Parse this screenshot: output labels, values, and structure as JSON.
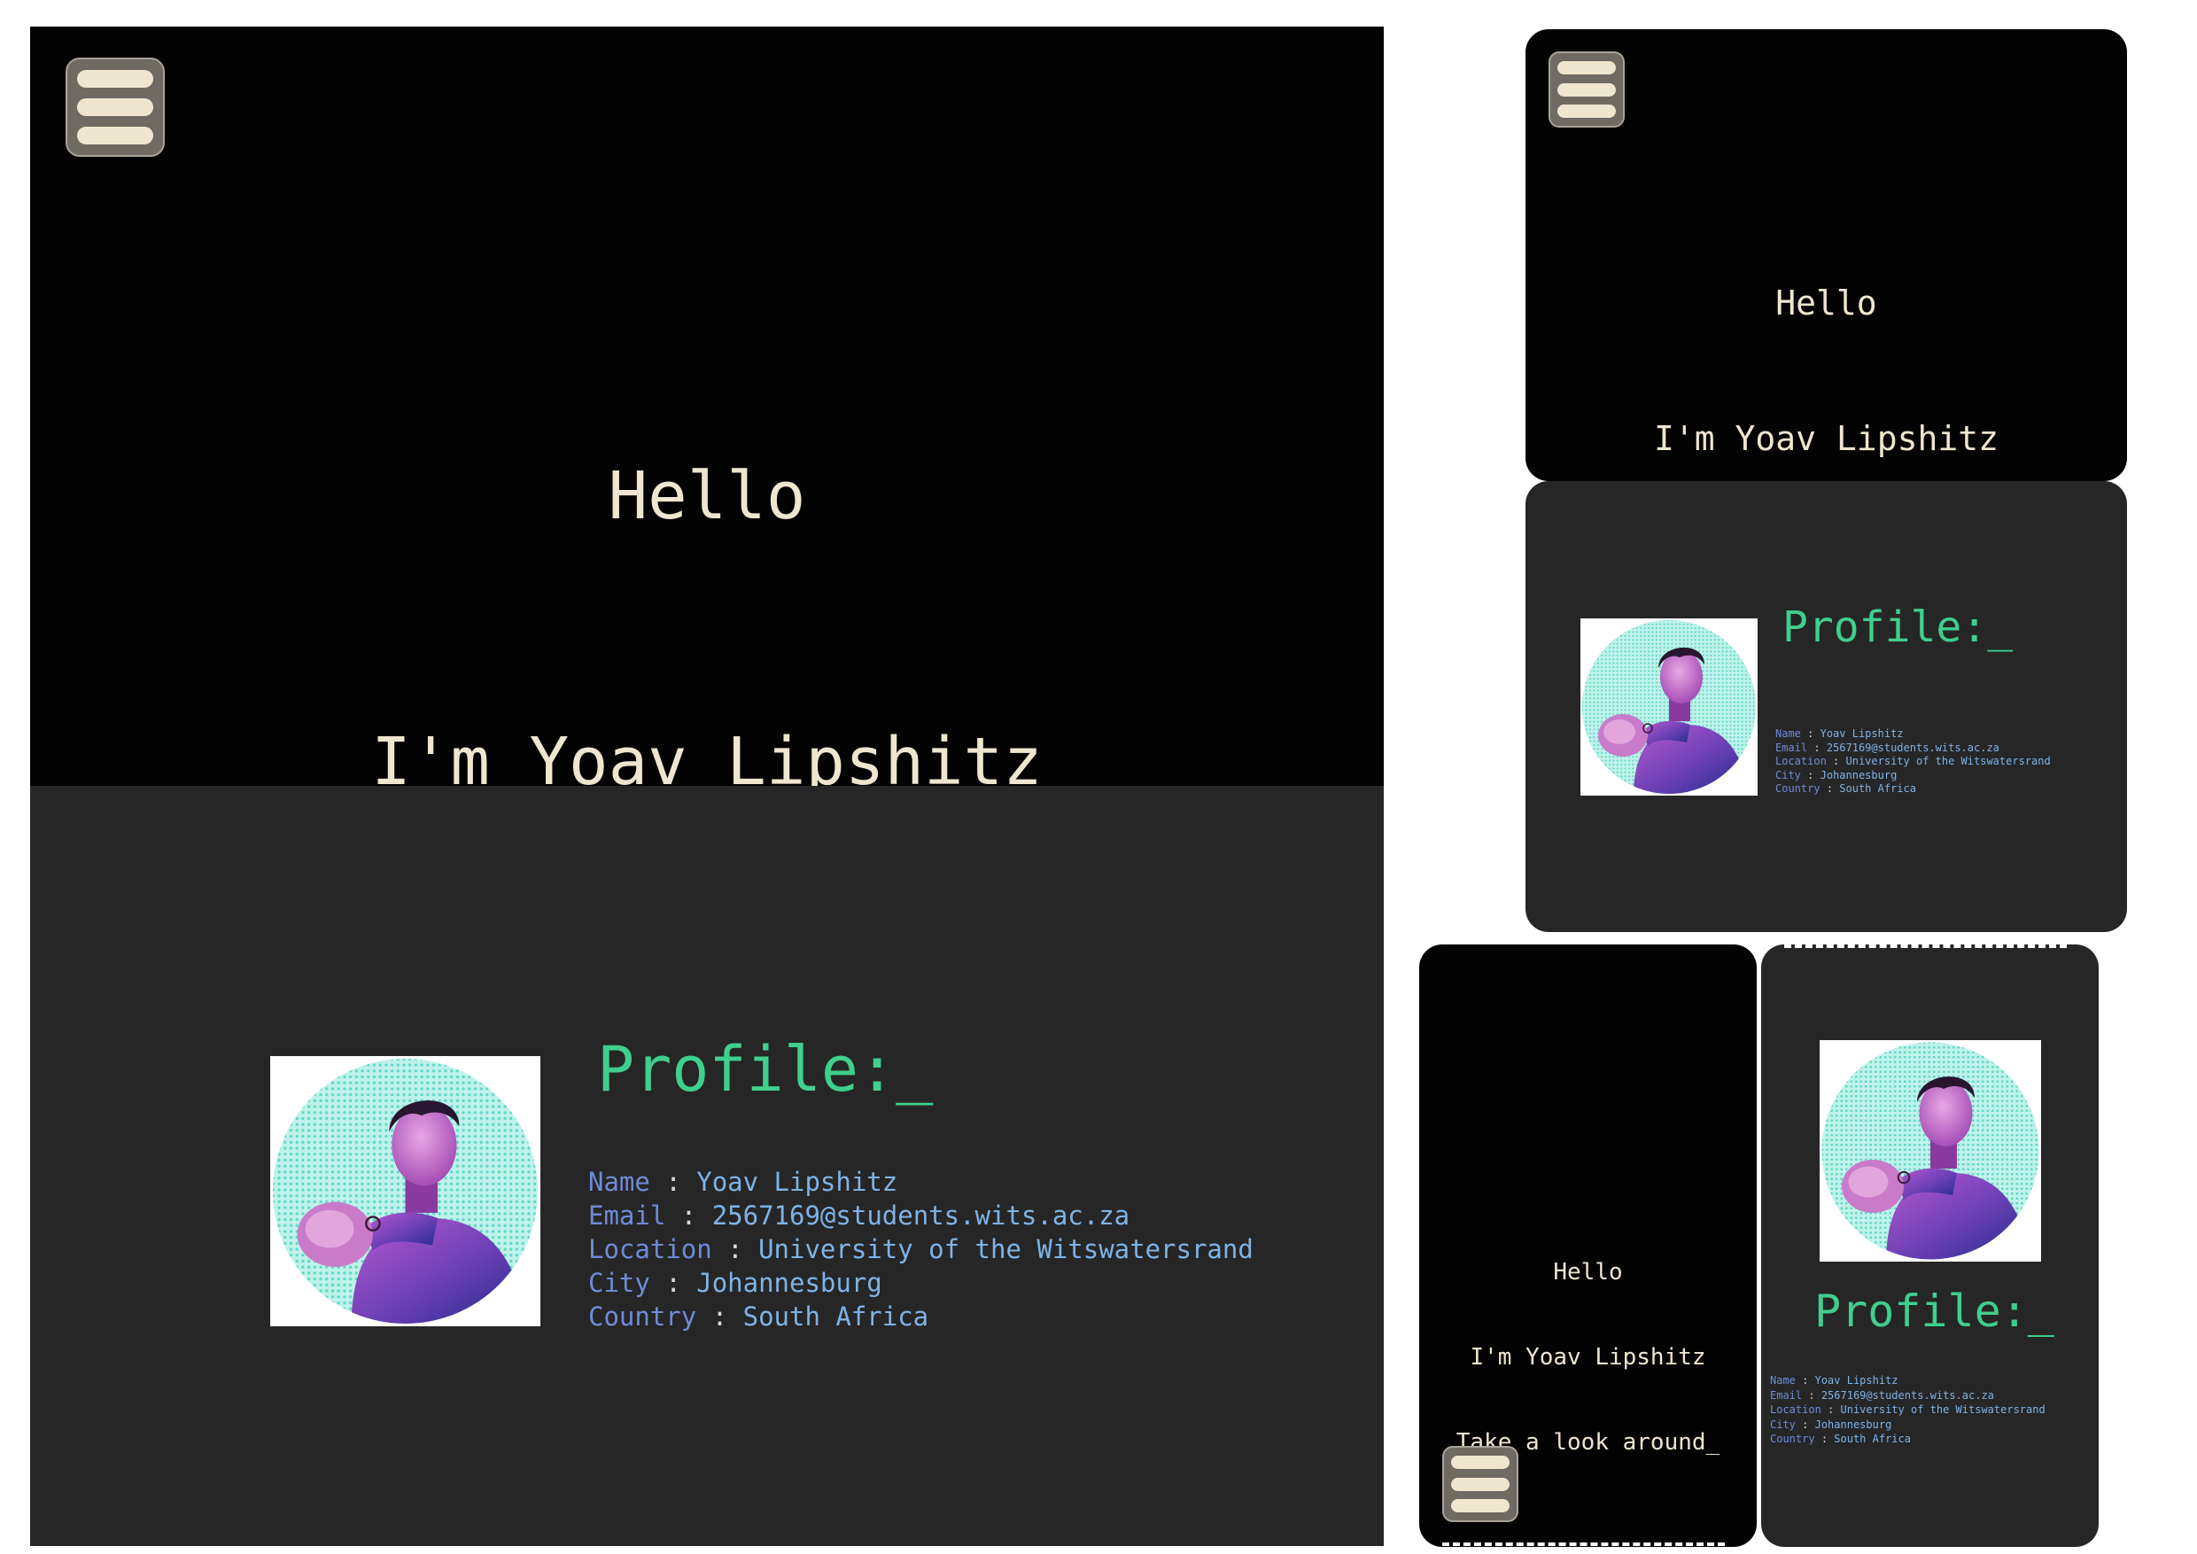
{
  "menu": {
    "icon": "hamburger-menu-icon"
  },
  "hero": {
    "line1": "Hello",
    "line2": "I'm Yoav Lipshitz",
    "line3": "Take a look around_"
  },
  "profile": {
    "title": "Profile:_",
    "separator": ":",
    "fields": [
      {
        "label": "Name",
        "value": "Yoav Lipshitz"
      },
      {
        "label": "Email",
        "value": "2567169@students.wits.ac.za"
      },
      {
        "label": "Location",
        "value": "University of the Witswatersrand"
      },
      {
        "label": "City",
        "value": "Johannesburg"
      },
      {
        "label": "Country",
        "value": "South Africa"
      }
    ]
  },
  "colors": {
    "hero_bg": "#030303",
    "section_bg": "#262626",
    "hero_text": "#efe6cf",
    "title_green": "#3fcf8e",
    "label_blue": "#6f8bd8",
    "value_blue": "#7fb3e6",
    "avatar_ring": "#8ee6d6"
  }
}
